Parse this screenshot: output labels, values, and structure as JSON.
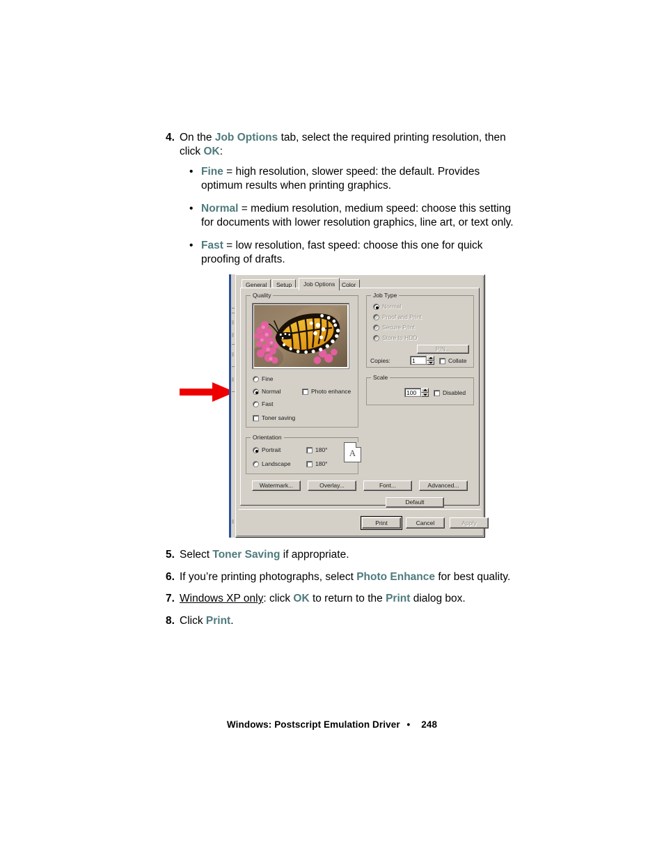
{
  "document": {
    "steps": [
      {
        "num": "4.",
        "parts": [
          {
            "t": "On the ",
            "kw": false
          },
          {
            "t": "Job Options",
            "kw": true
          },
          {
            "t": " tab, select the required printing resolution, then click ",
            "kw": false
          },
          {
            "t": "OK",
            "kw": true
          },
          {
            "t": ":",
            "kw": false
          }
        ],
        "bullets": [
          [
            {
              "t": "Fine",
              "kw": true
            },
            {
              "t": " = high resolution, slower speed: the default. Provides optimum results when printing graphics.",
              "kw": false
            }
          ],
          [
            {
              "t": "Normal",
              "kw": true
            },
            {
              "t": " = medium resolution, medium speed: choose this setting for documents with lower resolution graphics, line art, or text only.",
              "kw": false
            }
          ],
          [
            {
              "t": "Fast",
              "kw": true
            },
            {
              "t": " = low resolution, fast speed: choose this one for quick proofing of drafts.",
              "kw": false
            }
          ]
        ]
      }
    ],
    "steps_after": [
      {
        "num": "5.",
        "parts": [
          {
            "t": "Select ",
            "kw": false
          },
          {
            "t": "Toner Saving",
            "kw": true
          },
          {
            "t": " if appropriate.",
            "kw": false
          }
        ]
      },
      {
        "num": "6.",
        "parts": [
          {
            "t": "If you’re printing photographs, select ",
            "kw": false
          },
          {
            "t": "Photo Enhance",
            "kw": true
          },
          {
            "t": " for best quality.",
            "kw": false
          }
        ]
      },
      {
        "num": "7.",
        "parts": [
          {
            "t": "Windows XP only",
            "kw": false,
            "underline": true
          },
          {
            "t": ": click ",
            "kw": false
          },
          {
            "t": "OK",
            "kw": true
          },
          {
            "t": " to return to the ",
            "kw": false
          },
          {
            "t": "Print",
            "kw": true
          },
          {
            "t": " dialog box.",
            "kw": false
          }
        ]
      },
      {
        "num": "8.",
        "parts": [
          {
            "t": "Click ",
            "kw": false
          },
          {
            "t": "Print",
            "kw": true
          },
          {
            "t": ".",
            "kw": false
          }
        ]
      }
    ],
    "footer": {
      "title": "Windows: Postscript Emulation Driver",
      "separator": "•",
      "page_number": "248"
    },
    "keyword_color": "#4f7a7d",
    "annotation": {
      "arrow_color": "#ee0000",
      "arrow_points_to": "Normal radio button"
    }
  },
  "dialog": {
    "tabs": [
      {
        "label": "General",
        "active": false
      },
      {
        "label": "Setup",
        "active": false
      },
      {
        "label": "Job Options",
        "active": true
      },
      {
        "label": "Color",
        "active": false
      }
    ],
    "quality": {
      "group_label": "Quality",
      "preview_alt": "monarch-butterfly-on-pink-flowers",
      "radios": [
        {
          "label": "Fine",
          "selected": false
        },
        {
          "label": "Normal",
          "selected": true
        },
        {
          "label": "Fast",
          "selected": false
        }
      ],
      "photo_enhance": {
        "label": "Photo enhance",
        "checked": false
      },
      "toner_saving": {
        "label": "Toner saving",
        "checked": false
      }
    },
    "orientation": {
      "group_label": "Orientation",
      "radios": [
        {
          "label": "Portrait",
          "selected": true
        },
        {
          "label": "Landscape",
          "selected": false
        }
      ],
      "rotate_portrait": {
        "label": "180°",
        "checked": false
      },
      "rotate_landscape": {
        "label": "180°",
        "checked": false
      },
      "page_glyph": "A"
    },
    "job_type": {
      "group_label": "Job Type",
      "radios": [
        {
          "label": "Normal",
          "selected": true,
          "disabled": true
        },
        {
          "label": "Proof and Print",
          "selected": false,
          "disabled": true
        },
        {
          "label": "Secure Print",
          "selected": false,
          "disabled": true
        },
        {
          "label": "Store to HDD",
          "selected": false,
          "disabled": true
        }
      ],
      "pin_button": {
        "label": "PIN...",
        "disabled": true
      },
      "copies_label": "Copies:",
      "copies_value": "1",
      "collate": {
        "label": "Collate",
        "checked": false
      }
    },
    "scale": {
      "group_label": "Scale",
      "value": "100",
      "disabled_check": {
        "label": "Disabled",
        "checked": false
      }
    },
    "action_buttons": [
      {
        "label": "Watermark...",
        "disabled": false
      },
      {
        "label": "Overlay...",
        "disabled": false
      },
      {
        "label": "Font...",
        "disabled": false
      },
      {
        "label": "Advanced...",
        "disabled": false
      }
    ],
    "default_button": {
      "label": "Default"
    },
    "footer_buttons": [
      {
        "label": "Print",
        "disabled": false,
        "default": true
      },
      {
        "label": "Cancel",
        "disabled": false,
        "default": false
      },
      {
        "label": "Apply",
        "disabled": true,
        "default": false
      }
    ]
  }
}
